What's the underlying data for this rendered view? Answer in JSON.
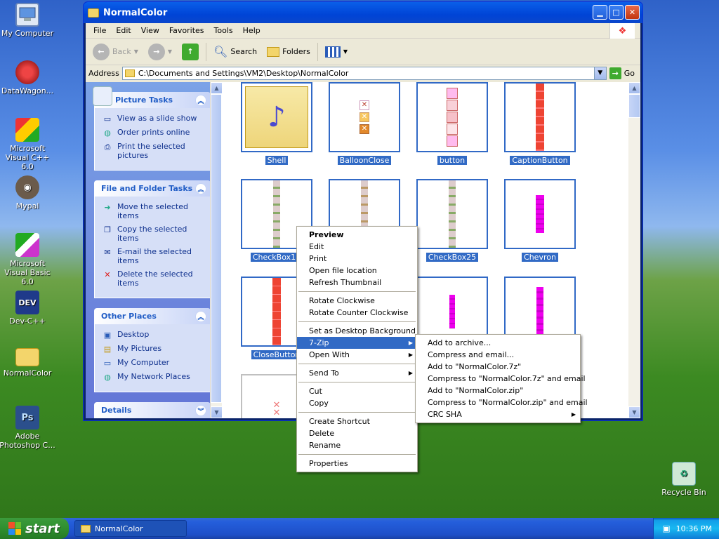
{
  "desktop": {
    "icons": [
      {
        "label": "My Computer"
      },
      {
        "label": "DataWagon..."
      },
      {
        "label": "Microsoft Visual C++ 6.0"
      },
      {
        "label": "Mypal"
      },
      {
        "label": "Microsoft Visual Basic 6.0"
      },
      {
        "label": "Dev-C++",
        "glyph": "DEV"
      },
      {
        "label": "NormalColor"
      },
      {
        "label": "Adobe Photoshop C...",
        "glyph": "Ps"
      },
      {
        "label": "Recycle Bin"
      }
    ]
  },
  "window": {
    "title": "NormalColor",
    "menu": [
      "File",
      "Edit",
      "View",
      "Favorites",
      "Tools",
      "Help"
    ],
    "toolbar": {
      "back": "Back",
      "search": "Search",
      "folders": "Folders"
    },
    "address": {
      "label": "Address",
      "value": "C:\\Documents and Settings\\VM2\\Desktop\\NormalColor",
      "go": "Go"
    }
  },
  "taskpane": {
    "picture_tasks": {
      "title": "Picture Tasks",
      "items": [
        "View as a slide show",
        "Order prints online",
        "Print the selected pictures"
      ]
    },
    "file_tasks": {
      "title": "File and Folder Tasks",
      "items": [
        "Move the selected items",
        "Copy the selected items",
        "E-mail the selected items",
        "Delete the selected items"
      ]
    },
    "other_places": {
      "title": "Other Places",
      "items": [
        "Desktop",
        "My Pictures",
        "My Computer",
        "My Network Places"
      ]
    },
    "details": {
      "title": "Details"
    }
  },
  "thumbnails": [
    "Shell",
    "BalloonClose",
    "button",
    "CaptionButton",
    "CheckBox13",
    "",
    "CheckBox25",
    "Chevron",
    "CloseButton",
    "",
    "",
    ""
  ],
  "context_menu": {
    "items": [
      "Preview",
      "Edit",
      "Print",
      "Open file location",
      "Refresh Thumbnail",
      "Rotate Clockwise",
      "Rotate Counter Clockwise",
      "Set as Desktop Background",
      "7-Zip",
      "Open With",
      "Send To",
      "Cut",
      "Copy",
      "Create Shortcut",
      "Delete",
      "Rename",
      "Properties"
    ]
  },
  "submenu_7zip": {
    "items": [
      "Add to archive...",
      "Compress and email...",
      "Add to \"NormalColor.7z\"",
      "Compress to \"NormalColor.7z\" and email",
      "Add to \"NormalColor.zip\"",
      "Compress to \"NormalColor.zip\" and email",
      "CRC SHA"
    ]
  },
  "taskbar": {
    "start": "start",
    "task": "NormalColor",
    "clock": "10:36 PM"
  },
  "colors": {
    "selection": "#316ac5",
    "title_bar": "#0054e3",
    "task_pane": "#7ba2e7"
  }
}
